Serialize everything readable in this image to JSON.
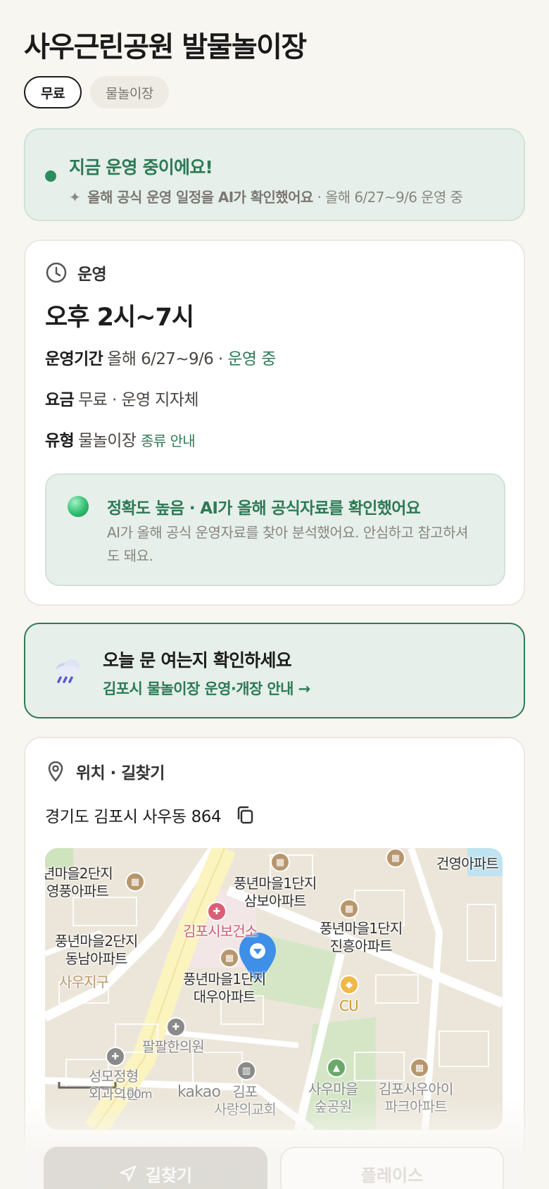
{
  "title": "사우근린공원 발물놀이장",
  "tags": [
    "무료",
    "물놀이장"
  ],
  "status": {
    "headline": "지금 운영 중이에요!",
    "sub_icon": "sparkle-icon",
    "sub_bold": "올해 공식 운영 일정을 AI가 확인했어요",
    "sub_rest": " · 올해 6/27~9/6 운영 중"
  },
  "operation": {
    "section_label": "운영",
    "hours": "오후 2시~7시",
    "period_label": "운영기간",
    "period_value": "올해 6/27~9/6 ·",
    "period_status": "운영 중",
    "fee_label": "요금",
    "fee_value": "무료 · 운영 지자체",
    "type_label": "유형",
    "type_value": "물놀이장",
    "type_link": "종류 안내",
    "accuracy_title": "정확도 높음 · AI가 올해 공식자료를 확인했어요",
    "accuracy_desc": "AI가 올해 공식 운영자료를 찾아 분석했어요. 안심하고 참고하셔도 돼요."
  },
  "notice": {
    "title": "오늘 문 여는지 확인하세요",
    "link": "김포시 물놀이장 운영·개장 안내 →"
  },
  "location": {
    "section_label": "위치 · 길찾기",
    "address": "경기도 김포시 사우동 864",
    "map_labels": {
      "a": "년마을2단지\n영풍아파트",
      "b": "풍년마을1단지\n삼보아파트",
      "c": "건영아파트",
      "d": "풍년마을1단지\n진흥아파트",
      "e": "김포시보건소",
      "f": "풍년마을2단지\n동남아파트",
      "g": "사우지구",
      "h": "풍년마을1단지\n대우아파트",
      "i": "CU",
      "j": "팔팔한의원",
      "k": "성모정형\n외과의원",
      "l": "김포\n사랑의교회",
      "m": "사우마을\n숲공원",
      "n": "김포사우아이\n파크아파트",
      "scale": "100m",
      "brand": "kakao"
    }
  },
  "buttons": {
    "directions": "길찾기",
    "place": "플레이스"
  }
}
